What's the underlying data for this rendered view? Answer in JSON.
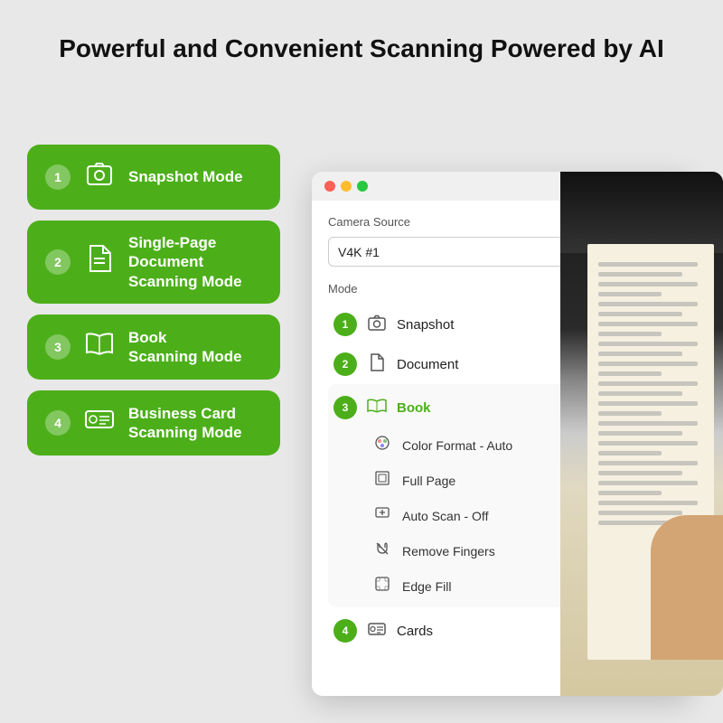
{
  "header": {
    "title": "Powerful and Convenient Scanning Powered by AI"
  },
  "left_modes": [
    {
      "number": "1",
      "icon": "📷",
      "label": "Snapshot Mode"
    },
    {
      "number": "2",
      "icon": "📄",
      "label": "Single-Page Document\nScanning Mode"
    },
    {
      "number": "3",
      "icon": "📖",
      "label": "Book\nScanning Mode"
    },
    {
      "number": "4",
      "icon": "💳",
      "label": "Business Card\nScanning Mode"
    }
  ],
  "app": {
    "camera_source_label": "Camera Source",
    "camera_value": "V4K #1",
    "mode_label": "Mode",
    "modes": [
      {
        "number": "1",
        "name": "Snapshot",
        "icon": "snapshot",
        "expanded": false
      },
      {
        "number": "2",
        "name": "Document",
        "icon": "document",
        "expanded": false,
        "chevron": "down"
      },
      {
        "number": "3",
        "name": "Book",
        "icon": "book",
        "expanded": true,
        "chevron": "up"
      },
      {
        "number": "4",
        "name": "Cards",
        "icon": "cards",
        "expanded": false,
        "chevron": "down"
      }
    ],
    "book_sub_options": [
      {
        "label": "Color Format - Auto",
        "type": "chevron"
      },
      {
        "label": "Full Page",
        "type": "chevron"
      },
      {
        "label": "Auto Scan - Off",
        "type": "chevron"
      },
      {
        "label": "Remove Fingers",
        "type": "toggle"
      },
      {
        "label": "Edge Fill",
        "type": "toggle"
      }
    ]
  }
}
